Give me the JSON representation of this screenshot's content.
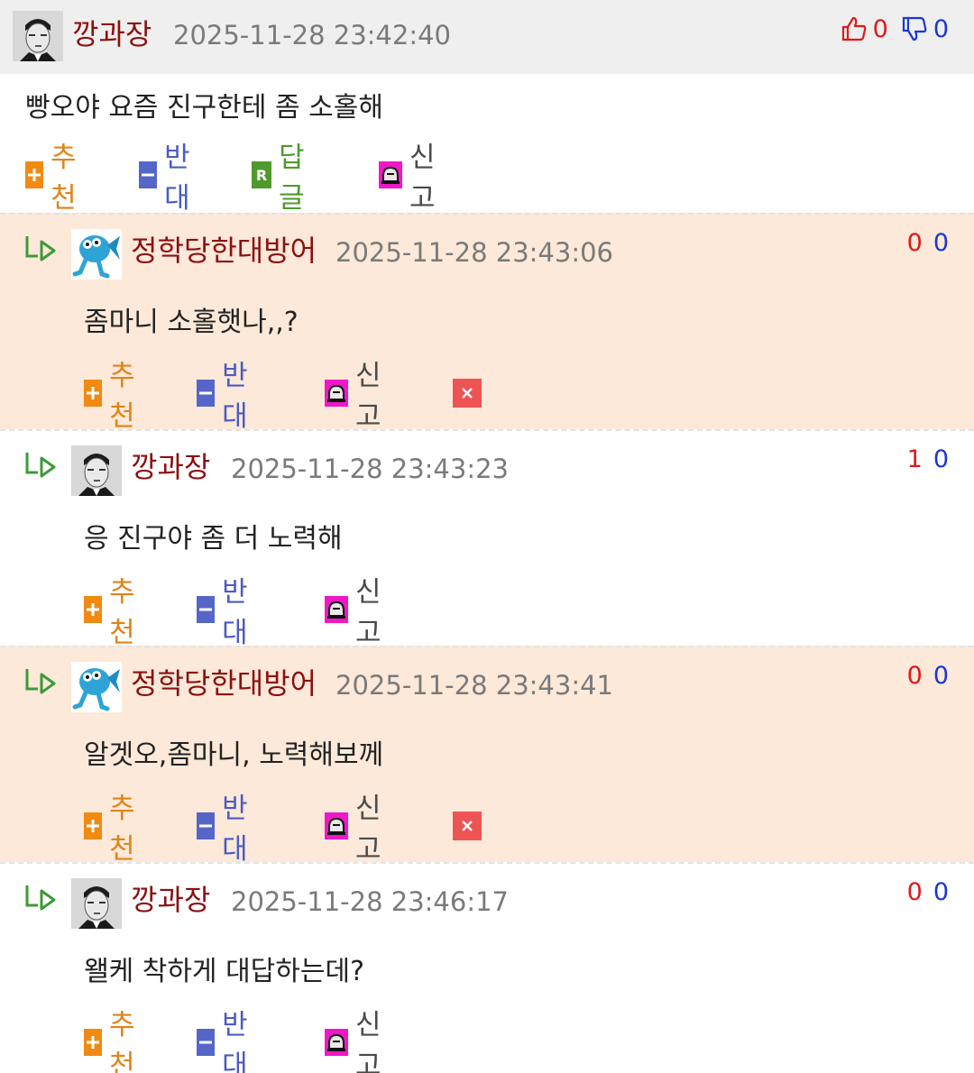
{
  "top_comment": {
    "nickname": "깡과장",
    "timestamp": "2025-11-28 23:42:40",
    "up_count": "0",
    "down_count": "0",
    "body": "빵오야 요즘 진구한테 좀 소홀해",
    "actions": {
      "recommend": "추천",
      "oppose": "반대",
      "reply": "답글",
      "report": "신고"
    },
    "avatar_icon": "man-photo-avatar"
  },
  "replies": [
    {
      "nickname": "정학당한대방어",
      "timestamp": "2025-11-28 23:43:06",
      "up": "0",
      "down": "0",
      "body": "좀마니 소홀햇나,,?",
      "highlight": true,
      "avatar_icon": "blue-fish-avatar",
      "recommend": "추천",
      "oppose": "반대",
      "report": "신고",
      "has_delete": true
    },
    {
      "nickname": "깡과장",
      "timestamp": "2025-11-28 23:43:23",
      "up": "1",
      "down": "0",
      "body": "응 진구야 좀 더 노력해",
      "highlight": false,
      "avatar_icon": "man-photo-avatar",
      "recommend": "추천",
      "oppose": "반대",
      "report": "신고",
      "has_delete": false
    },
    {
      "nickname": "정학당한대방어",
      "timestamp": "2025-11-28 23:43:41",
      "up": "0",
      "down": "0",
      "body": "알겟오,좀마니, 노력해보께",
      "highlight": true,
      "avatar_icon": "blue-fish-avatar",
      "recommend": "추천",
      "oppose": "반대",
      "report": "신고",
      "has_delete": true
    },
    {
      "nickname": "깡과장",
      "timestamp": "2025-11-28 23:46:17",
      "up": "0",
      "down": "0",
      "body": "왤케 착하게 대답하는데?",
      "highlight": false,
      "avatar_icon": "man-photo-avatar",
      "recommend": "추천",
      "oppose": "반대",
      "report": "신고",
      "has_delete": false
    }
  ],
  "colors": {
    "nickname": "#8b1010",
    "timestamp": "#7a7a7a",
    "highlight_bg": "#fce9d9",
    "up": "#e01818",
    "down": "#1a36d6",
    "recommend": "#f08a12",
    "oppose": "#5566c8",
    "reply": "#4f9a2c",
    "report_icon": "#ef18c8",
    "delete": "#ef5454"
  }
}
